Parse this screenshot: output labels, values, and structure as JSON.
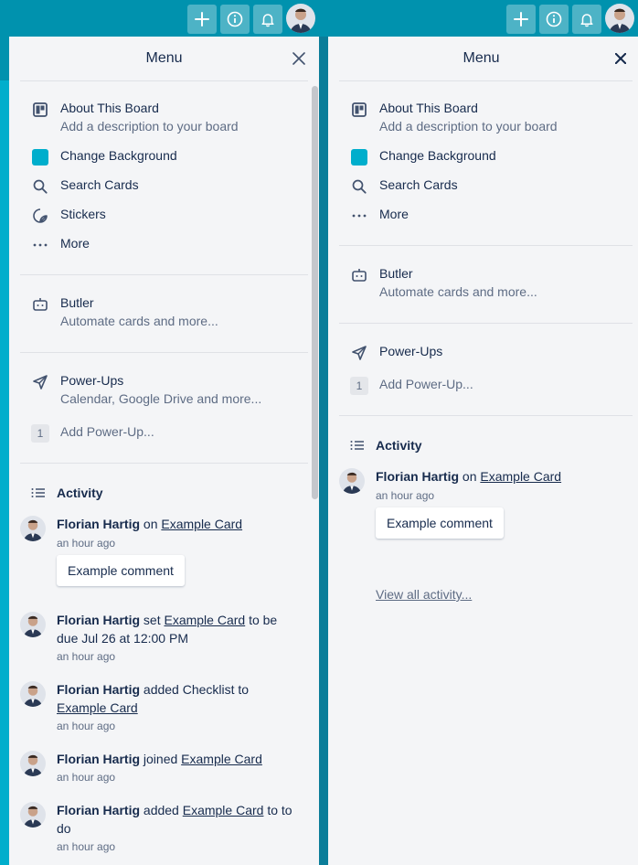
{
  "colors": {
    "accent": "#0092ae",
    "brand_swatch": "#00aecc",
    "panel_bg": "#f4f5f7"
  },
  "header": {
    "left_buttons": [
      {
        "icon": "plus-icon"
      },
      {
        "icon": "info-icon"
      },
      {
        "icon": "bell-icon"
      }
    ],
    "right_buttons": [
      {
        "icon": "plus-icon"
      },
      {
        "icon": "info-icon"
      },
      {
        "icon": "bell-icon"
      }
    ]
  },
  "left_menu": {
    "title": "Menu",
    "about": {
      "label": "About This Board",
      "sub": "Add a description to your board"
    },
    "change_bg": {
      "label": "Change Background"
    },
    "search": {
      "label": "Search Cards"
    },
    "stickers": {
      "label": "Stickers"
    },
    "more": {
      "label": "More"
    },
    "butler": {
      "label": "Butler",
      "sub": "Automate cards and more..."
    },
    "powerups": {
      "label": "Power-Ups",
      "sub": "Calendar, Google Drive and more...",
      "count": "1",
      "add": "Add Power-Up..."
    },
    "activity": {
      "title": "Activity",
      "entries": [
        {
          "user": "Florian Hartig",
          "pre": " on ",
          "link": "Example Card",
          "post": "",
          "line2": "",
          "time": "an hour ago",
          "comment": "Example comment"
        },
        {
          "user": "Florian Hartig",
          "pre": " set ",
          "link": "Example Card",
          "post": " to be",
          "line2": "due Jul 26 at 12:00 PM",
          "time": "an hour ago"
        },
        {
          "user": "Florian Hartig",
          "pre": " added Checklist to",
          "link": "Example Card",
          "post": "",
          "line2": "",
          "time": "an hour ago"
        },
        {
          "user": "Florian Hartig",
          "pre": " joined ",
          "link": "Example Card",
          "post": "",
          "line2": "",
          "time": "an hour ago"
        },
        {
          "user": "Florian Hartig",
          "pre": " added ",
          "link": "Example Card",
          "post": " to to",
          "line2": "do",
          "time": "an hour ago"
        }
      ]
    }
  },
  "right_menu": {
    "title": "Menu",
    "about": {
      "label": "About This Board",
      "sub": "Add a description to your board"
    },
    "change_bg": {
      "label": "Change Background"
    },
    "search": {
      "label": "Search Cards"
    },
    "more": {
      "label": "More"
    },
    "butler": {
      "label": "Butler",
      "sub": "Automate cards and more..."
    },
    "powerups": {
      "label": "Power-Ups",
      "count": "1",
      "add": "Add Power-Up..."
    },
    "activity": {
      "title": "Activity",
      "entry": {
        "user": "Florian Hartig",
        "pre": " on ",
        "link": "Example Card",
        "time": "an hour ago",
        "comment": "Example comment"
      },
      "view_all": "View all activity..."
    }
  }
}
